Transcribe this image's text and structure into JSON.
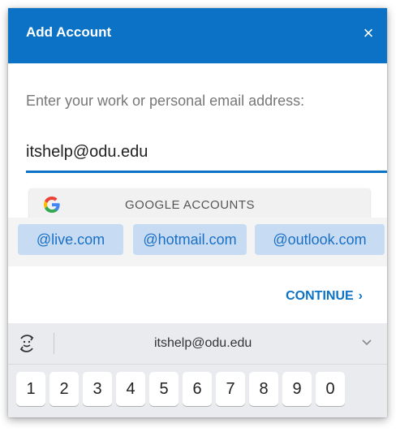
{
  "header": {
    "title": "Add Account",
    "close_glyph": "×"
  },
  "form": {
    "prompt": "Enter your work or personal email address:",
    "email_value": "itshelp@odu.edu",
    "google_button_label": "GOOGLE ACCOUNTS"
  },
  "suggestions": {
    "chips": [
      "@live.com",
      "@hotmail.com",
      "@outlook.com"
    ]
  },
  "actions": {
    "continue_label": "CONTINUE",
    "continue_chevron": "›"
  },
  "keyboard": {
    "suggestion": "itshelp@odu.edu",
    "number_keys": [
      "1",
      "2",
      "3",
      "4",
      "5",
      "6",
      "7",
      "8",
      "9",
      "0"
    ]
  },
  "colors": {
    "accent": "#0b72c6",
    "chip_background": "#c7dcf2"
  },
  "icons": {
    "google": "google-g-icon",
    "emoji": "emoji-icon",
    "expand": "chevron-down-icon",
    "close": "close-icon"
  }
}
